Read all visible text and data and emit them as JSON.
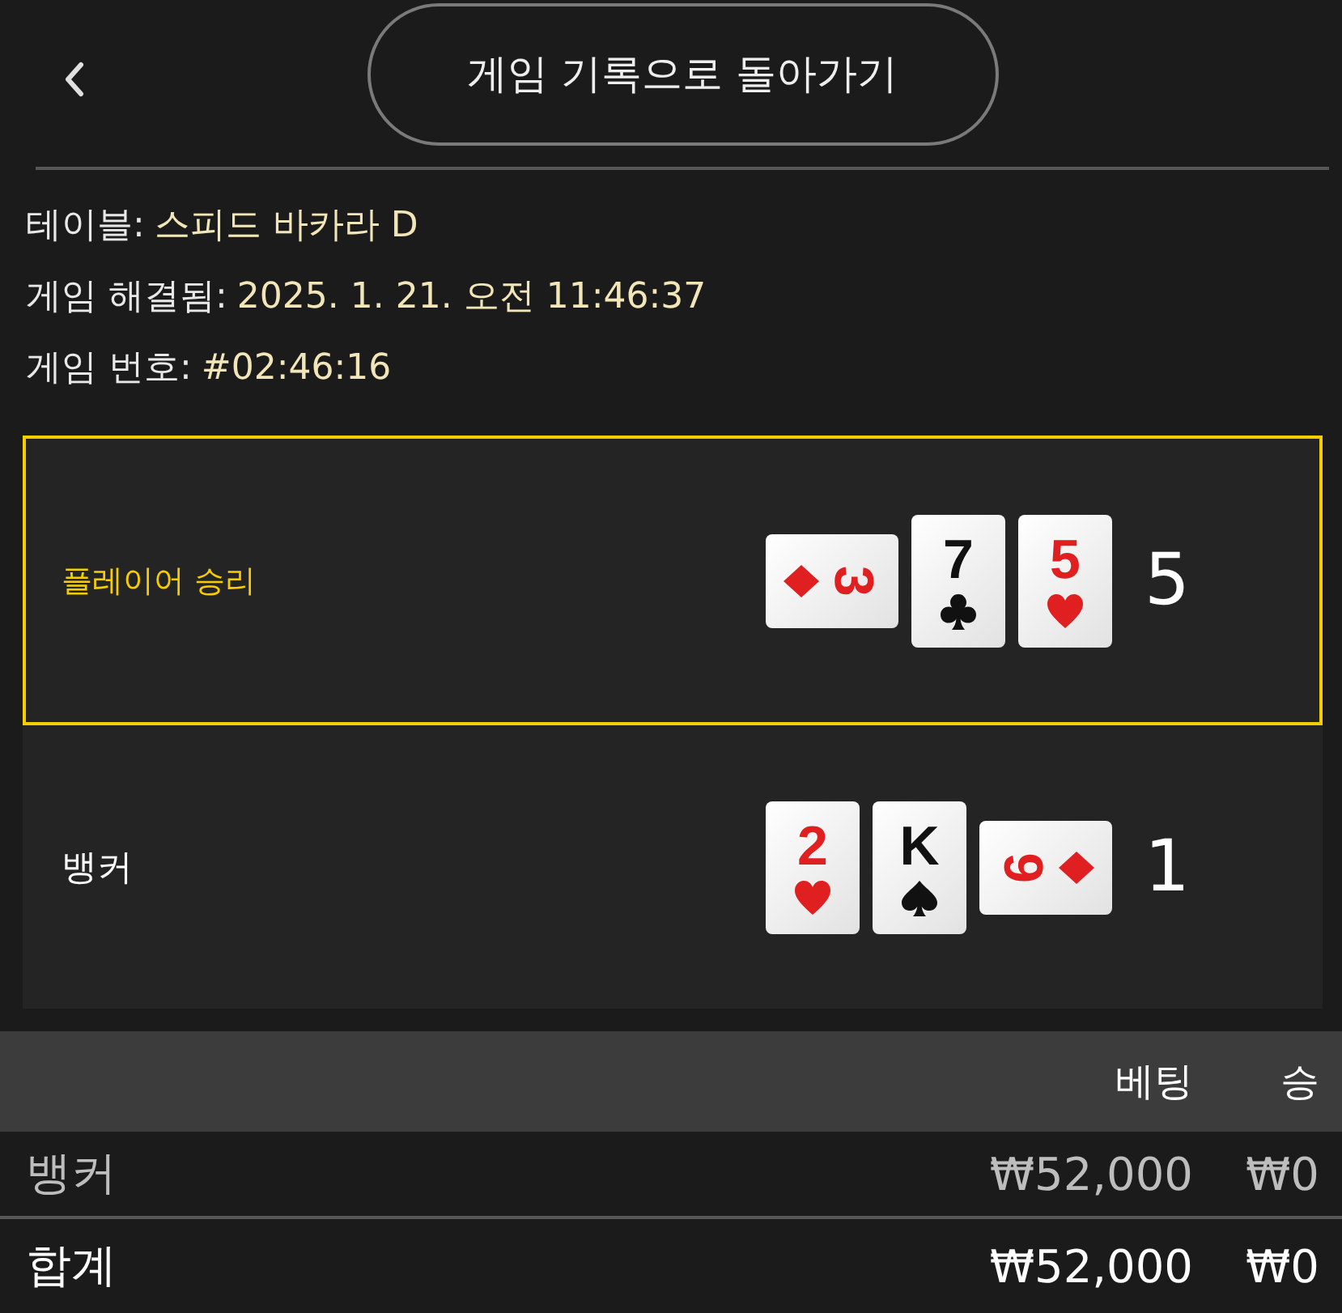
{
  "header": {
    "title_button": "게임 기록으로 돌아가기"
  },
  "info": [
    {
      "label": "테이블:",
      "value": "스피드 바카라 D"
    },
    {
      "label": "게임 해결됨:",
      "value": "2025. 1. 21. 오전 11:46:37"
    },
    {
      "label": "게임 번호:",
      "value": "#02:46:16"
    }
  ],
  "hands": [
    {
      "name": "플레이어 승리",
      "winner": true,
      "score": "5",
      "cards": [
        {
          "rank": "3",
          "kind": "diamond",
          "rotated_cw": true,
          "rotated_ccw": false
        },
        {
          "rank": "7",
          "kind": "club",
          "rotated_cw": false,
          "rotated_ccw": false
        },
        {
          "rank": "5",
          "kind": "heart",
          "rotated_cw": false,
          "rotated_ccw": false
        }
      ]
    },
    {
      "name": "뱅커",
      "winner": false,
      "score": "1",
      "cards": [
        {
          "rank": "2",
          "kind": "heart",
          "rotated_cw": false,
          "rotated_ccw": false
        },
        {
          "rank": "K",
          "kind": "spade",
          "rotated_cw": false,
          "rotated_ccw": false
        },
        {
          "rank": "6",
          "kind": "diamond",
          "rotated_cw": false,
          "rotated_ccw": true
        }
      ]
    }
  ],
  "bets_table": {
    "columns": [
      "베팅",
      "승"
    ],
    "rows": [
      {
        "kind": "bet",
        "label": "뱅커",
        "bet": "₩52,000",
        "win": "₩0"
      },
      {
        "kind": "total",
        "label": "합계",
        "bet": "₩52,000",
        "win": "₩0"
      }
    ]
  }
}
